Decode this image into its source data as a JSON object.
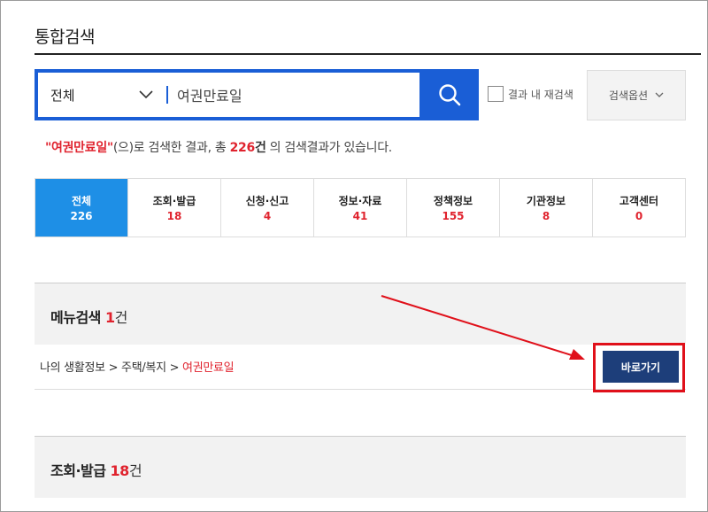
{
  "page": {
    "title": "통합검색"
  },
  "search": {
    "scope_label": "전체",
    "query": "여권만료일",
    "refine_label": "결과 내 재검색",
    "options_label": "검색옵션"
  },
  "result": {
    "keyword": "\"여권만료일\"",
    "text_a": "(으)로 검색한 결과, 총 ",
    "total": "226",
    "unit": "건",
    "text_b": " 의 검색결과가 있습니다."
  },
  "tabs": [
    {
      "label": "전체",
      "count": "226",
      "active": true
    },
    {
      "label": "조회·발급",
      "count": "18"
    },
    {
      "label": "신청·신고",
      "count": "4"
    },
    {
      "label": "정보·자료",
      "count": "41"
    },
    {
      "label": "정책정보",
      "count": "155"
    },
    {
      "label": "기관정보",
      "count": "8"
    },
    {
      "label": "고객센터",
      "count": "0"
    }
  ],
  "menu_section": {
    "title": "메뉴검색",
    "count": "1",
    "unit": "건",
    "path_prefix": "나의 생활정보 > 주택/복지 > ",
    "path_highlight": "여권만료일",
    "go_label": "바로가기"
  },
  "issue_section": {
    "title": "조회·발급",
    "count": "18",
    "unit": "건"
  },
  "colors": {
    "accent_blue": "#1a5ed6",
    "tab_active": "#1e8fe6",
    "highlight_red": "#e0232e",
    "button_navy": "#1d3e7a"
  },
  "icons": {
    "search": "search-icon",
    "scope_dropdown": "chevron-down-icon",
    "options_dropdown": "chevron-down-icon"
  }
}
